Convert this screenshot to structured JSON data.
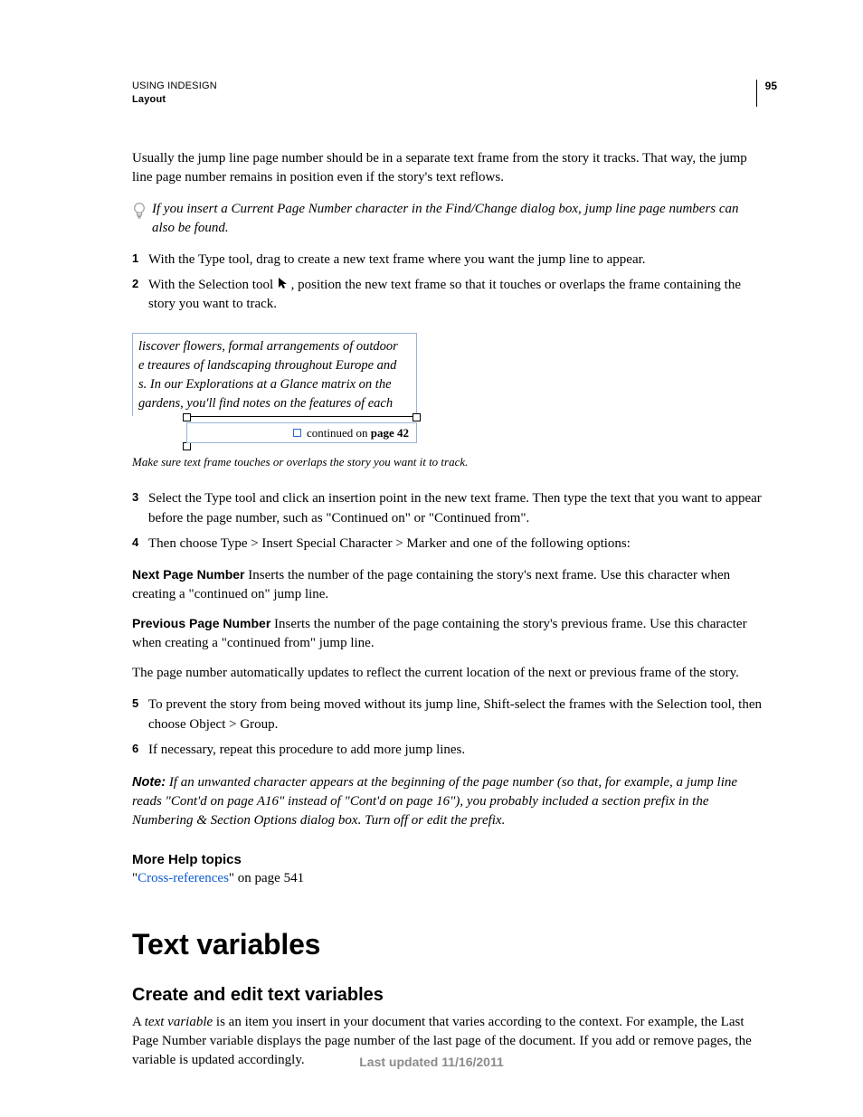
{
  "header": {
    "product": "USING INDESIGN",
    "chapter": "Layout",
    "page_number": "95"
  },
  "intro_para": "Usually the jump line page number should be in a separate text frame from the story it tracks. That way, the jump line page number remains in position even if the story's text reflows.",
  "tip": "If you insert a Current Page Number character in the Find/Change dialog box, jump line page numbers can also be found.",
  "steps_a": {
    "s1": "With the Type tool, drag to create a new text frame where you want the jump line to appear.",
    "s2_pre": "With the Selection tool ",
    "s2_post": " , position the new text frame so that it touches or overlaps the frame containing the story you want to track."
  },
  "figure": {
    "line1": "liscover flowers, formal arrangements of outdoor",
    "line2": "e treaures of landscaping throughout Europe and",
    "line3": "s. In our Explorations at a Glance matrix on the",
    "line4": "gardens, you'll find notes on the features of each",
    "jump_text_pre": "continued on ",
    "jump_text_b": "page 42",
    "caption": "Make sure text frame touches or overlaps the story you want it to track."
  },
  "steps_b": {
    "s3": "Select the Type tool and click an insertion point in the new text frame. Then type the text that you want to appear before the page number, such as \"Continued on\" or \"Continued from\".",
    "s4": "Then choose Type > Insert Special Character > Marker and one of the following options:"
  },
  "options": {
    "next_head": "Next Page Number",
    "next_body": " Inserts the number of the page containing the story's next frame. Use this character when creating a \"continued on\" jump line.",
    "prev_head": "Previous Page Number",
    "prev_body": " Inserts the number of the page containing the story's previous frame. Use this character when creating a \"continued from\" jump line."
  },
  "auto_update": "The page number automatically updates to reflect the current location of the next or previous frame of the story.",
  "steps_c": {
    "s5": "To prevent the story from being moved without its jump line, Shift-select the frames with the Selection tool, then choose Object > Group.",
    "s6": "If necessary, repeat this procedure to add more jump lines."
  },
  "note": {
    "label": "Note:",
    "body": " If an unwanted character appears at the beginning of the page number (so that, for example, a jump line reads \"Cont'd on page A16\" instead of \"Cont'd on page 16\"), you probably included a section prefix in the Numbering & Section Options dialog box. Turn off or edit the prefix."
  },
  "more_help": {
    "heading": "More Help topics",
    "link_text": "Cross-references",
    "suffix": "\" on page 541",
    "prefix": "\""
  },
  "h1": "Text variables",
  "h2": "Create and edit text variables",
  "tv_para_pre": "A ",
  "tv_para_term": "text variable",
  "tv_para_post": " is an item you insert in your document that varies according to the context. For example, the Last Page Number variable displays the page number of the last page of the document. If you add or remove pages, the variable is updated accordingly.",
  "footer": "Last updated 11/16/2011"
}
